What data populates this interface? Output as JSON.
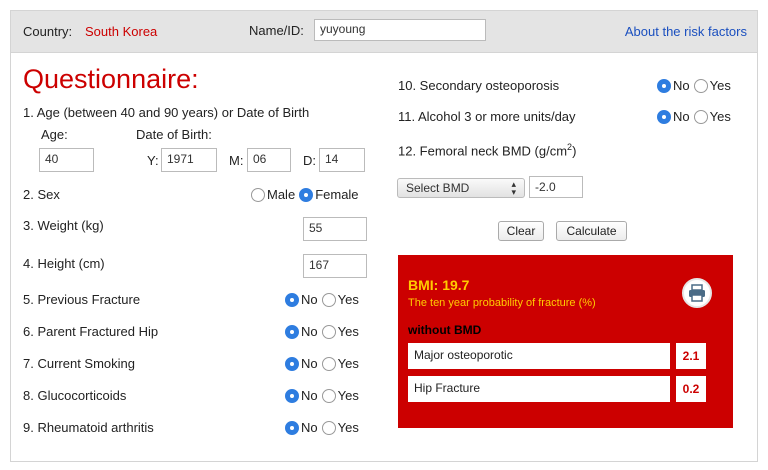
{
  "header": {
    "country_label": "Country:",
    "country_value": "South Korea",
    "name_label": "Name/ID:",
    "name_value": "yuyoung",
    "about_link": "About the risk factors"
  },
  "questionnaire": {
    "title": "Questionnaire:",
    "q1": {
      "label": "1. Age (between 40 and 90 years) or Date of Birth",
      "age_label": "Age:",
      "dob_label": "Date of Birth:",
      "age_value": "40",
      "y_label": "Y:",
      "y_value": "1971",
      "m_label": "M:",
      "m_value": "06",
      "d_label": "D:",
      "d_value": "14"
    },
    "q2": {
      "label": "2. Sex",
      "opt1": "Male",
      "opt2": "Female",
      "selected": "Female"
    },
    "q3": {
      "label": "3. Weight (kg)",
      "value": "55"
    },
    "q4": {
      "label": "4. Height (cm)",
      "value": "167"
    },
    "q5": {
      "label": "5. Previous Fracture"
    },
    "q6": {
      "label": "6. Parent Fractured Hip"
    },
    "q7": {
      "label": "7. Current Smoking"
    },
    "q8": {
      "label": "8. Glucocorticoids"
    },
    "q9": {
      "label": "9. Rheumatoid arthritis"
    },
    "q10": {
      "label": "10. Secondary osteoporosis"
    },
    "q11": {
      "label": "11. Alcohol 3 or more units/day"
    },
    "q12": {
      "label": "12. Femoral neck BMD (g/cm",
      "sup": "2",
      "tail": ")",
      "select_value": "Select BMD",
      "bmd_value": "-2.0"
    },
    "no_label": "No",
    "yes_label": "Yes"
  },
  "buttons": {
    "clear": "Clear",
    "calculate": "Calculate"
  },
  "result": {
    "bmi": "BMI: 19.7",
    "prob_title": "The ten year probability of fracture (%)",
    "without_bmd": "without BMD",
    "major_label": "Major osteoporotic",
    "major_value": "2.1",
    "hip_label": "Hip Fracture",
    "hip_value": "0.2"
  },
  "icons": {
    "print": "printer-icon",
    "select_arrow": "updown-arrow-icon"
  },
  "colors": {
    "accent_red": "#cc0000",
    "radio_blue": "#2e7de0",
    "result_yellow": "#ffcc00",
    "link_blue": "#1a4fbf"
  }
}
